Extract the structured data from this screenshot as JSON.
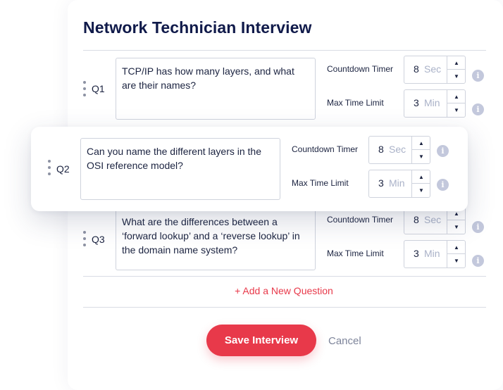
{
  "page": {
    "title": "Network Technician Interview",
    "add_question": "+ Add a New Question",
    "save_label": "Save Interview",
    "cancel_label": "Cancel"
  },
  "labels": {
    "countdown": "Countdown Timer",
    "max_time": "Max Time Limit"
  },
  "questions": [
    {
      "id": "Q1",
      "text": "TCP/IP has how many layers, and what are their names?",
      "countdown_value": "8",
      "countdown_unit": "Sec",
      "max_value": "3",
      "max_unit": "Min"
    },
    {
      "id": "Q2",
      "text": "Can you name the different layers in the OSI reference model?",
      "countdown_value": "8",
      "countdown_unit": "Sec",
      "max_value": "3",
      "max_unit": "Min"
    },
    {
      "id": "Q3",
      "text": "What are the differences between a ‘forward lookup’ and a ‘reverse lookup’ in the domain name system?",
      "countdown_value": "8",
      "countdown_unit": "Sec",
      "max_value": "3",
      "max_unit": "Min"
    }
  ],
  "icons": {
    "arrow_up": "▲",
    "arrow_down": "▼",
    "info": "i"
  },
  "colors": {
    "accent": "#e8394a",
    "title": "#101a4a",
    "muted": "#aab2c8",
    "info_icon": "#c3c8dc"
  }
}
